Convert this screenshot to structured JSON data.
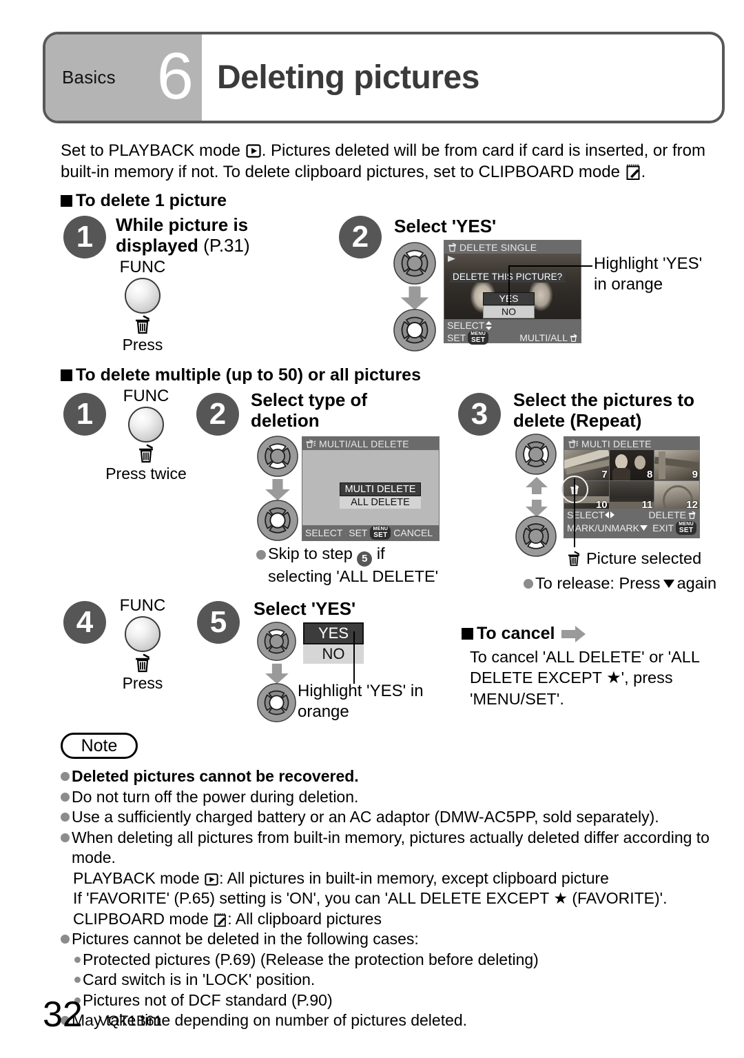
{
  "header": {
    "section": "Basics",
    "number": "6",
    "title": "Deleting pictures"
  },
  "intro": {
    "line1_a": "Set to PLAYBACK mode",
    "line1_b": ". Pictures deleted will be from card if card is inserted, or from",
    "line2_a": "built-in memory if not. To delete clipboard pictures, set to CLIPBOARD mode",
    "line2_b": "."
  },
  "section_single": {
    "heading": "To delete 1 picture",
    "step1": {
      "number": "1",
      "title_bold": "While picture is displayed",
      "title_ref": "(P.31)",
      "func_label": "FUNC",
      "press_label": "Press"
    },
    "step2": {
      "number": "2",
      "title": "Select 'YES'",
      "annotation_line1": "Highlight 'YES'",
      "annotation_line2": "in orange",
      "lcd": {
        "title": "DELETE SINGLE",
        "prompt": "DELETE THIS PICTURE?",
        "option_yes": "YES",
        "option_no": "NO",
        "foot_select": "SELECT",
        "foot_set": "SET",
        "foot_set_pill": "SET",
        "foot_set_pill_top": "MENU",
        "foot_right": "MULTI/ALL"
      }
    }
  },
  "section_multi": {
    "heading": "To delete multiple (up to 50) or all pictures",
    "step1": {
      "number": "1",
      "func_label": "FUNC",
      "press_label": "Press twice"
    },
    "step2": {
      "number": "2",
      "title_line1": "Select type of",
      "title_line2": "deletion",
      "note_line1": "Skip to step",
      "note_step": "5",
      "note_line1_end": "if",
      "note_line2": "selecting 'ALL DELETE'",
      "lcd": {
        "title": "MULTI/ALL DELETE",
        "option_multi": "MULTI DELETE",
        "option_all": "ALL DELETE",
        "foot_select": "SELECT",
        "foot_set": "SET",
        "foot_set_pill": "SET",
        "foot_set_pill_top": "MENU",
        "foot_cancel": "CANCEL"
      }
    },
    "step3": {
      "number": "3",
      "title_line1": "Select the pictures to",
      "title_line2": "delete (Repeat)",
      "caption_selected": "Picture selected",
      "caption_release": "To release: Press",
      "caption_release_end": "again",
      "lcd": {
        "title": "MULTI DELETE",
        "thumbnails": [
          "7",
          "8",
          "9",
          "10",
          "11",
          "12"
        ],
        "foot_select": "SELECT",
        "foot_delete": "DELETE",
        "foot_mark": "MARK/UNMARK",
        "foot_exit": "EXIT",
        "foot_exit_pill": "SET",
        "foot_exit_pill_top": "MENU"
      }
    },
    "step4": {
      "number": "4",
      "func_label": "FUNC",
      "press_label": "Press"
    },
    "step5": {
      "number": "5",
      "title": "Select 'YES'",
      "option_yes": "YES",
      "option_no": "NO",
      "annotation_line1": "Highlight 'YES' in",
      "annotation_line2": "orange"
    }
  },
  "section_cancel": {
    "heading": "To cancel",
    "line1": "To cancel 'ALL DELETE' or 'ALL",
    "line2_a": "DELETE EXCEPT",
    "line2_b": "', press",
    "line3": "'MENU/SET'."
  },
  "note": {
    "label": "Note",
    "items": [
      {
        "text": "Deleted pictures cannot be recovered.",
        "bold": true
      },
      {
        "text": "Do not turn off the power during deletion.",
        "bold": false
      },
      {
        "text": "Use a sufficiently charged battery or an AC adaptor (DMW-AC5PP, sold separately).",
        "bold": false
      },
      {
        "text": "When deleting all pictures from built-in memory, pictures actually deleted differ according to mode.",
        "bold": false
      }
    ],
    "mode_playback_a": "PLAYBACK mode",
    "mode_playback_b": ": All pictures in built-in memory, except clipboard picture",
    "favorite_a": "If 'FAVORITE' (P.65) setting is 'ON', you can 'ALL DELETE EXCEPT",
    "favorite_b": "(FAVORITE)'.",
    "mode_clipboard_a": "CLIPBOARD mode",
    "mode_clipboard_b": ": All clipboard pictures",
    "cases_heading": "Pictures cannot be deleted in the following cases:",
    "cases": [
      "Protected pictures (P.69) (Release the protection before deleting)",
      "Card switch is in 'LOCK' position.",
      "Pictures not of DCF standard (P.90)"
    ],
    "last": "May take time depending on number of pictures deleted."
  },
  "footer": {
    "page_number": "32",
    "code": "VQT1B61"
  },
  "colors": {
    "banner_border": "#58585a",
    "banner_left_bg": "#b4b4b4",
    "bubble_bg": "#565656",
    "lcd_chrome": "#6b6b6b",
    "highlight": "#3c3c3c"
  }
}
